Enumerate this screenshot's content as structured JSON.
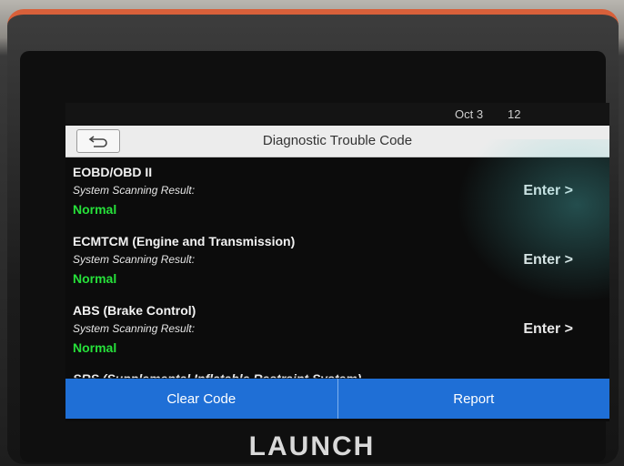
{
  "status_bar": {
    "date": "Oct 3",
    "time": "12"
  },
  "header": {
    "title": "Diagnostic Trouble Code",
    "back_icon": "back-arrow-icon"
  },
  "systems": [
    {
      "name": "EOBD/OBD II",
      "label": "System Scanning Result:",
      "status": "Normal",
      "enter": "Enter >"
    },
    {
      "name": "ECMTCM (Engine and Transmission)",
      "label": "System Scanning Result:",
      "status": "Normal",
      "enter": "Enter >"
    },
    {
      "name": "ABS (Brake Control)",
      "label": "System Scanning Result:",
      "status": "Normal",
      "enter": "Enter >"
    }
  ],
  "partial_item": {
    "name": "SRS (Supplemental Inflatable Restraint System)"
  },
  "footer": {
    "clear_label": "Clear Code",
    "report_label": "Report"
  },
  "brand": "LAUNCH",
  "colors": {
    "status_ok": "#26e03a",
    "button_blue": "#1f6fd6",
    "frame_accent": "#d8603a"
  }
}
